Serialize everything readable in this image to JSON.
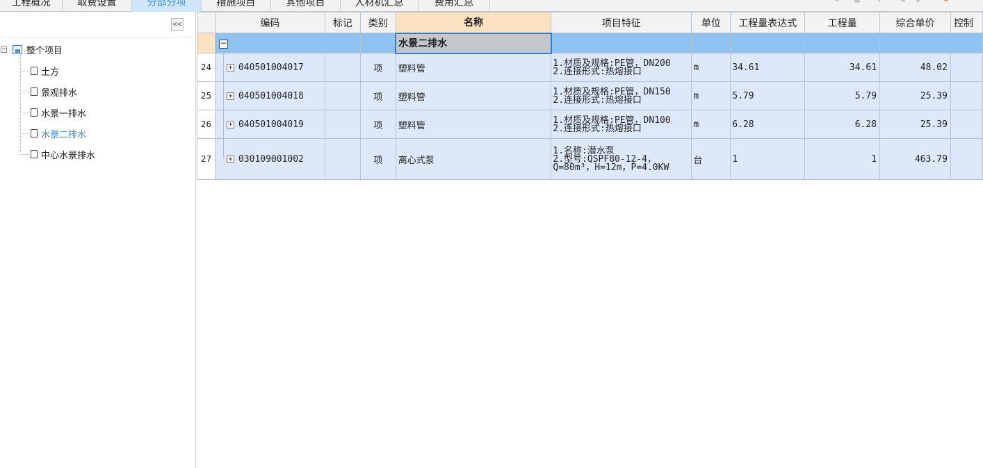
{
  "tabs": [
    {
      "label": "工程概况",
      "active": false
    },
    {
      "label": "取费设置",
      "active": false
    },
    {
      "label": "分部分项",
      "active": true
    },
    {
      "label": "措施项目",
      "active": false
    },
    {
      "label": "其他项目",
      "active": false
    },
    {
      "label": "人材机汇总",
      "active": false
    },
    {
      "label": "费用汇总",
      "active": false
    }
  ],
  "tree": {
    "collapse_label": "<<",
    "root": "整个项目",
    "items": [
      {
        "label": "土方"
      },
      {
        "label": "景观排水"
      },
      {
        "label": "水景一排水"
      },
      {
        "label": "水景二排水",
        "selected": true
      },
      {
        "label": "中心水景排水"
      }
    ]
  },
  "grid": {
    "columns": [
      "",
      "编码",
      "标记",
      "类别",
      "名称",
      "项目特征",
      "单位",
      "工程量表达式",
      "工程量",
      "综合单价",
      "控制"
    ],
    "group": {
      "toggle": "−",
      "name": "水景二排水"
    },
    "rows": [
      {
        "num": "24",
        "code": "040501004017",
        "mark": "",
        "type": "项",
        "name": "塑料管",
        "feature": "1.材质及规格:PE管，DN200\n2.连接形式:热熔接口",
        "unit": "m",
        "expr": "34.61",
        "qty": "34.61",
        "price": "48.02"
      },
      {
        "num": "25",
        "code": "040501004018",
        "mark": "",
        "type": "项",
        "name": "塑料管",
        "feature": "1.材质及规格:PE管，DN150\n2.连接形式:热熔接口",
        "unit": "m",
        "expr": "5.79",
        "qty": "5.79",
        "price": "25.39"
      },
      {
        "num": "26",
        "code": "040501004019",
        "mark": "",
        "type": "项",
        "name": "塑料管",
        "feature": "1.材质及规格:PE管，DN100\n2.连接形式:热熔接口",
        "unit": "m",
        "expr": "6.28",
        "qty": "6.28",
        "price": "25.39"
      },
      {
        "num": "27",
        "code": "030109001002",
        "mark": "",
        "type": "项",
        "name": "离心式泵",
        "feature": "1.名称:潜水泵\n2.型号:QSPF80-12-4，\nQ=80m³，H=12m，P=4.0KW",
        "unit": "台",
        "expr": "1",
        "qty": "1",
        "price": "463.79"
      }
    ]
  },
  "colors": {
    "selected_tab": "#cfe6fb",
    "group_row": "#8fc3f2",
    "data_row": "#dde9fb",
    "active_header": "#fde2c2",
    "selection_border": "#2f7fd6"
  }
}
